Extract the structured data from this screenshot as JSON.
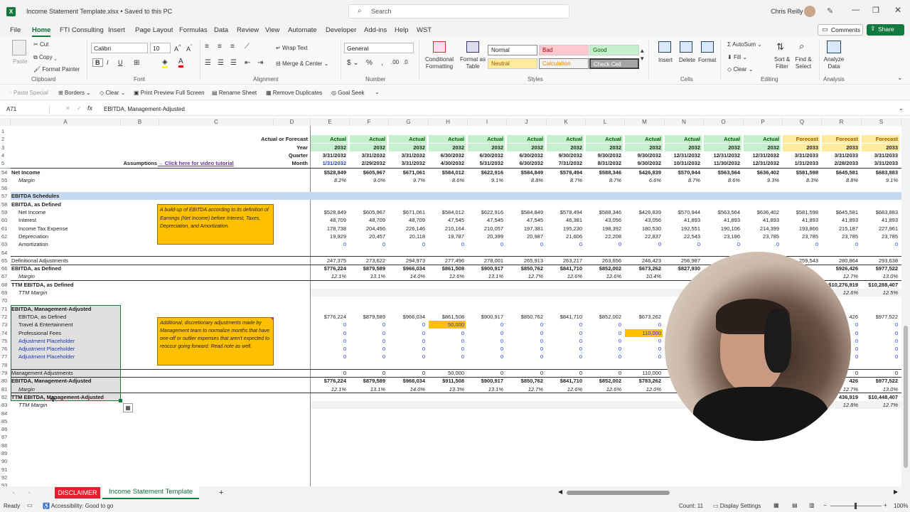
{
  "window": {
    "file_title": "Income Statement Template.xlsx  •  Saved to this PC",
    "search_placeholder": "Search",
    "user_name": "Chris Reilly"
  },
  "menu": {
    "items": [
      "File",
      "Home",
      "FTI Consulting",
      "Insert",
      "Page Layout",
      "Formulas",
      "Data",
      "Review",
      "View",
      "Automate",
      "Developer",
      "Add-ins",
      "Help",
      "WST"
    ],
    "active": "Home",
    "comments": "Comments",
    "share": "Share"
  },
  "ribbon": {
    "clipboard": {
      "paste": "Paste",
      "cut": "Cut",
      "copy": "Copy",
      "format_painter": "Format Painter",
      "label": "Clipboard"
    },
    "font": {
      "name": "Calibri",
      "size": "10",
      "label": "Font"
    },
    "alignment": {
      "wrap": "Wrap Text",
      "merge": "Merge & Center",
      "label": "Alignment"
    },
    "number": {
      "format": "General",
      "label": "Number"
    },
    "styles": {
      "conditional": "Conditional Formatting",
      "format_table": "Format as Table",
      "normal": "Normal",
      "bad": "Bad",
      "good": "Good",
      "neutral": "Neutral",
      "calculation": "Calculation",
      "check_cell": "Check Cell",
      "label": "Styles"
    },
    "cells": {
      "insert": "Insert",
      "delete": "Delete",
      "format": "Format",
      "label": "Cells"
    },
    "editing": {
      "autosum": "AutoSum",
      "fill": "Fill",
      "clear": "Clear",
      "sort": "Sort & Filter",
      "find": "Find & Select",
      "label": "Editing"
    },
    "analysis": {
      "analyze": "Analyze Data",
      "label": "Analysis"
    }
  },
  "quick_access": [
    "Paste Special",
    "Borders",
    "Clear",
    "Print Preview Full Screen",
    "Rename Sheet",
    "Remove Duplicates",
    "Goal Seek"
  ],
  "formula_bar": {
    "name_box": "A71",
    "content": "EBITDA, Management-Adjusted"
  },
  "columns": [
    "A",
    "B",
    "C",
    "D",
    "E",
    "F",
    "G",
    "H",
    "I",
    "J",
    "K",
    "L",
    "M",
    "N",
    "O",
    "P",
    "Q",
    "R",
    "S"
  ],
  "header_rows": {
    "actual_forecast_label": "Actual or Forecast",
    "year_label": "Year",
    "quarter_label": "Quarter",
    "assumptions_label": "Assumptions",
    "tutorial_link": "→ Click here for video tutorial",
    "month_label": "Month",
    "af": [
      "Actual",
      "Actual",
      "Actual",
      "Actual",
      "Actual",
      "Actual",
      "Actual",
      "Actual",
      "Actual",
      "Actual",
      "Actual",
      "Actual",
      "Forecast",
      "Forecast",
      "Forecast"
    ],
    "year": [
      "2032",
      "2032",
      "2032",
      "2032",
      "2032",
      "2032",
      "2032",
      "2032",
      "2032",
      "2032",
      "2032",
      "2032",
      "2033",
      "2033",
      "2033"
    ],
    "quarter": [
      "3/31/2032",
      "3/31/2032",
      "3/31/2032",
      "6/30/2032",
      "6/30/2032",
      "6/30/2032",
      "9/30/2032",
      "9/30/2032",
      "9/30/2032",
      "12/31/2032",
      "12/31/2032",
      "12/31/2032",
      "3/31/2033",
      "3/31/2033",
      "3/31/2033"
    ],
    "month": [
      "1/31/2032",
      "2/29/2032",
      "3/31/2032",
      "4/30/2032",
      "5/31/2032",
      "6/30/2032",
      "7/31/2032",
      "8/31/2032",
      "9/30/2032",
      "10/31/2032",
      "11/30/2032",
      "12/31/2032",
      "1/31/2033",
      "2/28/2033",
      "3/31/2033"
    ]
  },
  "rows": [
    {
      "n": "54",
      "label": "Net Income",
      "style": "bold",
      "vals": [
        "$528,849",
        "$605,967",
        "$671,061",
        "$584,012",
        "$622,916",
        "$584,849",
        "$578,494",
        "$588,346",
        "$426,839",
        "$570,944",
        "$563,564",
        "$636,402",
        "$581,598",
        "$645,581",
        "$683,883"
      ]
    },
    {
      "n": "55",
      "label": "Margin",
      "style": "ital",
      "indent": 1,
      "vals": [
        "8.2%",
        "9.0%",
        "9.7%",
        "8.6%",
        "9.1%",
        "8.8%",
        "8.7%",
        "8.7%",
        "6.6%",
        "8.7%",
        "8.6%",
        "9.3%",
        "8.3%",
        "8.8%",
        "9.1%"
      ]
    },
    {
      "n": "56",
      "label": "",
      "vals": []
    },
    {
      "n": "57",
      "label": "EBITDA Schedules",
      "style": "section",
      "vals": []
    },
    {
      "n": "58",
      "label": "EBITDA, as Defined",
      "style": "bold",
      "vals": []
    },
    {
      "n": "59",
      "label": "Net Income",
      "indent": 1,
      "vals": [
        "$528,849",
        "$605,967",
        "$671,061",
        "$584,012",
        "$622,916",
        "$584,849",
        "$578,494",
        "$588,346",
        "$426,839",
        "$570,944",
        "$563,564",
        "$636,402",
        "$581,598",
        "$645,581",
        "$683,883"
      ]
    },
    {
      "n": "60",
      "label": "Interest",
      "indent": 1,
      "vals": [
        "48,709",
        "48,709",
        "48,709",
        "47,545",
        "47,545",
        "47,545",
        "46,381",
        "43,056",
        "43,056",
        "41,893",
        "41,893",
        "41,893",
        "41,893",
        "41,893",
        "41,893"
      ]
    },
    {
      "n": "61",
      "label": "Income Tax Expense",
      "indent": 1,
      "vals": [
        "178,738",
        "204,456",
        "226,146",
        "210,164",
        "210,057",
        "197,381",
        "195,230",
        "198,392",
        "180,530",
        "192,551",
        "190,106",
        "214,399",
        "193,866",
        "215,187",
        "227,961"
      ]
    },
    {
      "n": "62",
      "label": "Depreciation",
      "indent": 1,
      "vals": [
        "19,929",
        "20,457",
        "20,118",
        "19,787",
        "20,399",
        "20,987",
        "21,606",
        "22,208",
        "22,837",
        "22,543",
        "23,186",
        "23,785",
        "23,785",
        "23,785",
        "23,785"
      ]
    },
    {
      "n": "63",
      "label": "Amortization",
      "indent": 1,
      "vals": [
        "0",
        "0",
        "0",
        "0",
        "0",
        "0",
        "0",
        "0",
        "0",
        "0",
        "0",
        "0",
        "0",
        "0",
        "0"
      ],
      "blue": true
    },
    {
      "n": "64",
      "label": "",
      "vals": []
    },
    {
      "n": "65",
      "label": "Definitional Adjustments",
      "vals": [
        "247,375",
        "273,622",
        "294,973",
        "277,496",
        "278,001",
        "265,913",
        "263,217",
        "263,656",
        "246,423",
        "256,987",
        "",
        "",
        "259,543",
        "280,864",
        "293,638"
      ]
    },
    {
      "n": "66",
      "label": "EBITDA, as Defined",
      "style": "bold",
      "vals": [
        "$776,224",
        "$879,589",
        "$966,034",
        "$861,508",
        "$900,917",
        "$850,762",
        "$841,710",
        "$852,002",
        "$673,262",
        "$827,930",
        "",
        "",
        "",
        "$926,426",
        "$977,522"
      ]
    },
    {
      "n": "67",
      "label": "Margin",
      "style": "ital",
      "indent": 1,
      "vals": [
        "12.1%",
        "13.1%",
        "14.0%",
        "12.6%",
        "13.1%",
        "12.7%",
        "12.6%",
        "12.6%",
        "10.4%",
        "",
        "",
        "",
        "",
        "12.7%",
        "13.0%"
      ]
    },
    {
      "n": "68",
      "label": "TTM EBITDA, as Defined",
      "style": "bold",
      "vals": [
        "",
        "",
        "",
        "",
        "",
        "",
        "",
        "",
        "",
        "",
        "",
        "",
        "",
        "$10,276,919",
        "$10,288,407"
      ]
    },
    {
      "n": "69",
      "label": "TTM Margin",
      "style": "ital",
      "indent": 1,
      "vals": [
        "",
        "",
        "",
        "",
        "",
        "",
        "",
        "",
        "",
        "",
        "",
        "",
        "",
        "12.6%",
        "12.5%"
      ]
    },
    {
      "n": "70",
      "label": "",
      "vals": []
    },
    {
      "n": "71",
      "label": "EBITDA, Management-Adjusted",
      "style": "bold",
      "vals": []
    },
    {
      "n": "72",
      "label": "EBITDA, as Defined",
      "indent": 1,
      "vals": [
        "$776,224",
        "$879,589",
        "$966,034",
        "$861,508",
        "$900,917",
        "$850,762",
        "$841,710",
        "$852,002",
        "$673,262",
        "",
        "",
        "",
        "",
        "426",
        "$977,522"
      ]
    },
    {
      "n": "73",
      "label": "Travel & Entertainment",
      "indent": 1,
      "vals": [
        "0",
        "0",
        "0",
        "50,000",
        "0",
        "0",
        "0",
        "0",
        "0",
        "",
        "",
        "",
        "",
        "0",
        "0"
      ],
      "blue": true
    },
    {
      "n": "74",
      "label": "Professional Fees",
      "indent": 1,
      "vals": [
        "0",
        "0",
        "0",
        "0",
        "0",
        "0",
        "0",
        "0",
        "110,000",
        "",
        "",
        "",
        "",
        "0",
        "0"
      ],
      "blue": true
    },
    {
      "n": "75",
      "label": "Adjustment Placeholder",
      "indent": 1,
      "bluelabel": true,
      "vals": [
        "0",
        "0",
        "0",
        "0",
        "0",
        "0",
        "0",
        "0",
        "0",
        "",
        "",
        "",
        "",
        "0",
        "0"
      ],
      "blue": true
    },
    {
      "n": "76",
      "label": "Adjustment Placeholder",
      "indent": 1,
      "bluelabel": true,
      "vals": [
        "0",
        "0",
        "0",
        "0",
        "0",
        "0",
        "0",
        "0",
        "0",
        "",
        "",
        "",
        "",
        "0",
        "0"
      ],
      "blue": true
    },
    {
      "n": "77",
      "label": "Adjustment Placeholder",
      "indent": 1,
      "bluelabel": true,
      "vals": [
        "0",
        "0",
        "0",
        "0",
        "0",
        "0",
        "0",
        "0",
        "0",
        "",
        "",
        "",
        "",
        "0",
        "0"
      ],
      "blue": true
    },
    {
      "n": "78",
      "label": "",
      "vals": []
    },
    {
      "n": "79",
      "label": "Management Adjustments",
      "vals": [
        "0",
        "0",
        "0",
        "50,000",
        "0",
        "0",
        "0",
        "0",
        "110,000",
        "",
        "",
        "",
        "",
        "0",
        "0"
      ]
    },
    {
      "n": "80",
      "label": "EBITDA, Management-Adjusted",
      "style": "bold",
      "vals": [
        "$776,224",
        "$879,589",
        "$966,034",
        "$911,508",
        "$900,917",
        "$850,762",
        "$841,710",
        "$852,002",
        "$783,262",
        "",
        "",
        "",
        "",
        "426",
        "$977,522"
      ]
    },
    {
      "n": "81",
      "label": "Margin",
      "style": "ital",
      "indent": 1,
      "vals": [
        "12.1%",
        "13.1%",
        "14.0%",
        "13.3%",
        "13.1%",
        "12.7%",
        "12.6%",
        "12.6%",
        "12.0%",
        "",
        "",
        "",
        "",
        "12.7%",
        "13.0%"
      ]
    },
    {
      "n": "82",
      "label": "TTM EBITDA, Management-Adjusted",
      "style": "bold",
      "vals": [
        "",
        "",
        "",
        "",
        "",
        "",
        "",
        "",
        "",
        "",
        "",
        "",
        "",
        "436,919",
        "$10,448,407"
      ]
    },
    {
      "n": "83",
      "label": "TTM Margin",
      "style": "ital",
      "indent": 1,
      "vals": [
        "",
        "",
        "",
        "",
        "",
        "",
        "",
        "",
        "",
        "",
        "",
        "",
        "",
        "12.8%",
        "12.7%"
      ]
    },
    {
      "n": "84",
      "label": "",
      "vals": []
    },
    {
      "n": "85",
      "label": "",
      "vals": []
    },
    {
      "n": "86",
      "label": "",
      "vals": []
    },
    {
      "n": "87",
      "label": "",
      "vals": []
    },
    {
      "n": "88",
      "label": "",
      "vals": []
    },
    {
      "n": "89",
      "label": "",
      "vals": []
    },
    {
      "n": "90",
      "label": "",
      "vals": []
    },
    {
      "n": "91",
      "label": "",
      "vals": []
    },
    {
      "n": "92",
      "label": "",
      "vals": []
    },
    {
      "n": "93",
      "label": "",
      "vals": []
    }
  ],
  "notes": {
    "note1": "A build-up of EBITDA according to its definition of Earnings (Net Income) before Interest, Taxes, Depreciation, and Amortization.",
    "note2": "Additional, discretionary adjustments made by Management team to normalize months that have one-off or outlier expenses that aren't expected to reoccur going forward. Read note as well."
  },
  "sheet_tabs": {
    "disclaimer": "DISCLAIMER",
    "active": "Income Statement Template",
    "add": "+"
  },
  "status": {
    "ready": "Ready",
    "accessibility": "Accessibility: Good to go",
    "count": "Count: 11",
    "display": "Display Settings",
    "zoom": "100%"
  },
  "colors": {
    "excel_green": "#127a3e",
    "actual_fill": "#c6efce",
    "forecast_fill": "#ffeb9c",
    "section_fill": "#c5d9f1",
    "note_fill": "#ffc000",
    "disclaimer_red": "#e0202a"
  }
}
